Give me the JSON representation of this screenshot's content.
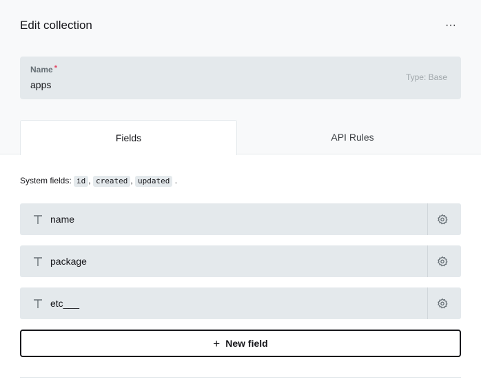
{
  "header": {
    "title": "Edit collection",
    "more_label": "···"
  },
  "name_field": {
    "label": "Name",
    "required_mark": "*",
    "value": "apps",
    "type_label": "Type: Base"
  },
  "tabs": [
    {
      "label": "Fields",
      "active": true
    },
    {
      "label": "API Rules",
      "active": false
    }
  ],
  "system_fields": {
    "prefix": "System fields:",
    "fields": [
      "id",
      "created",
      "updated"
    ],
    "sep": ",",
    "end": "."
  },
  "fields": [
    {
      "name": "name",
      "type_icon": "text-type-icon"
    },
    {
      "name": "package",
      "type_icon": "text-type-icon"
    },
    {
      "name": "etc___",
      "type_icon": "text-type-icon"
    }
  ],
  "new_field_button": {
    "plus": "+",
    "label": "New field"
  }
}
